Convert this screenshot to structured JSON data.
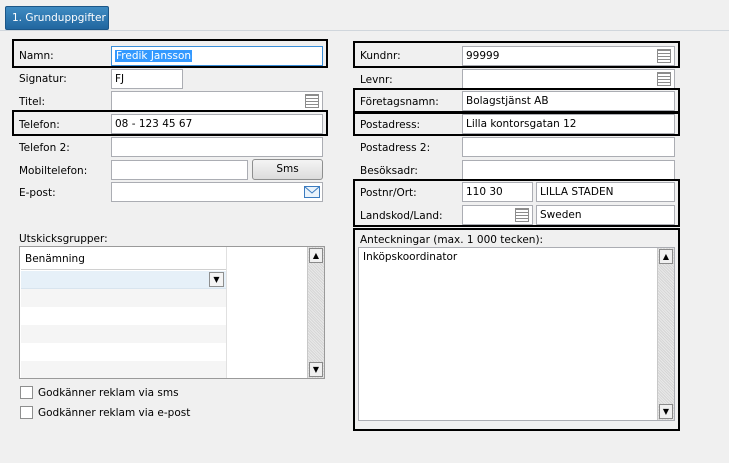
{
  "tab": {
    "label": "1. Grunduppgifter"
  },
  "left": {
    "name_label": "Namn:",
    "name_value": "Fredik Jansson",
    "signature_label": "Signatur:",
    "signature_value": "FJ",
    "title_label": "Titel:",
    "title_value": "",
    "phone_label": "Telefon:",
    "phone_value": "08 - 123 45 67",
    "phone2_label": "Telefon 2:",
    "phone2_value": "",
    "mobile_label": "Mobiltelefon:",
    "mobile_value": "",
    "sms_button": "Sms",
    "email_label": "E-post:",
    "email_value": ""
  },
  "groups": {
    "label": "Utskicksgrupper:",
    "column_header": "Benämning"
  },
  "consent": {
    "sms_label": "Godkänner reklam via sms",
    "email_label": "Godkänner reklam via e-post"
  },
  "right": {
    "customer_no_label": "Kundnr:",
    "customer_no_value": "99999",
    "supplier_no_label": "Levnr:",
    "supplier_no_value": "",
    "company_label": "Företagsnamn:",
    "company_value": "Bolagstjänst AB",
    "postal_address_label": "Postadress:",
    "postal_address_value": "Lilla kontorsgatan 12",
    "postal_address2_label": "Postadress 2:",
    "postal_address2_value": "",
    "visit_address_label": "Besöksadr:",
    "visit_address_value": "",
    "zip_city_label": "Postnr/Ort:",
    "zip_value": "110 30",
    "city_value": "LILLA STADEN",
    "country_label": "Landskod/Land:",
    "country_code_value": "",
    "country_value": "Sweden",
    "notes_label": "Anteckningar (max. 1 000 tecken):",
    "notes_value": "Inköpskoordinator"
  },
  "icons": {
    "lookup": "list-lookup-icon",
    "mail": "envelope-icon",
    "dropdown": "chevron-down-icon"
  }
}
